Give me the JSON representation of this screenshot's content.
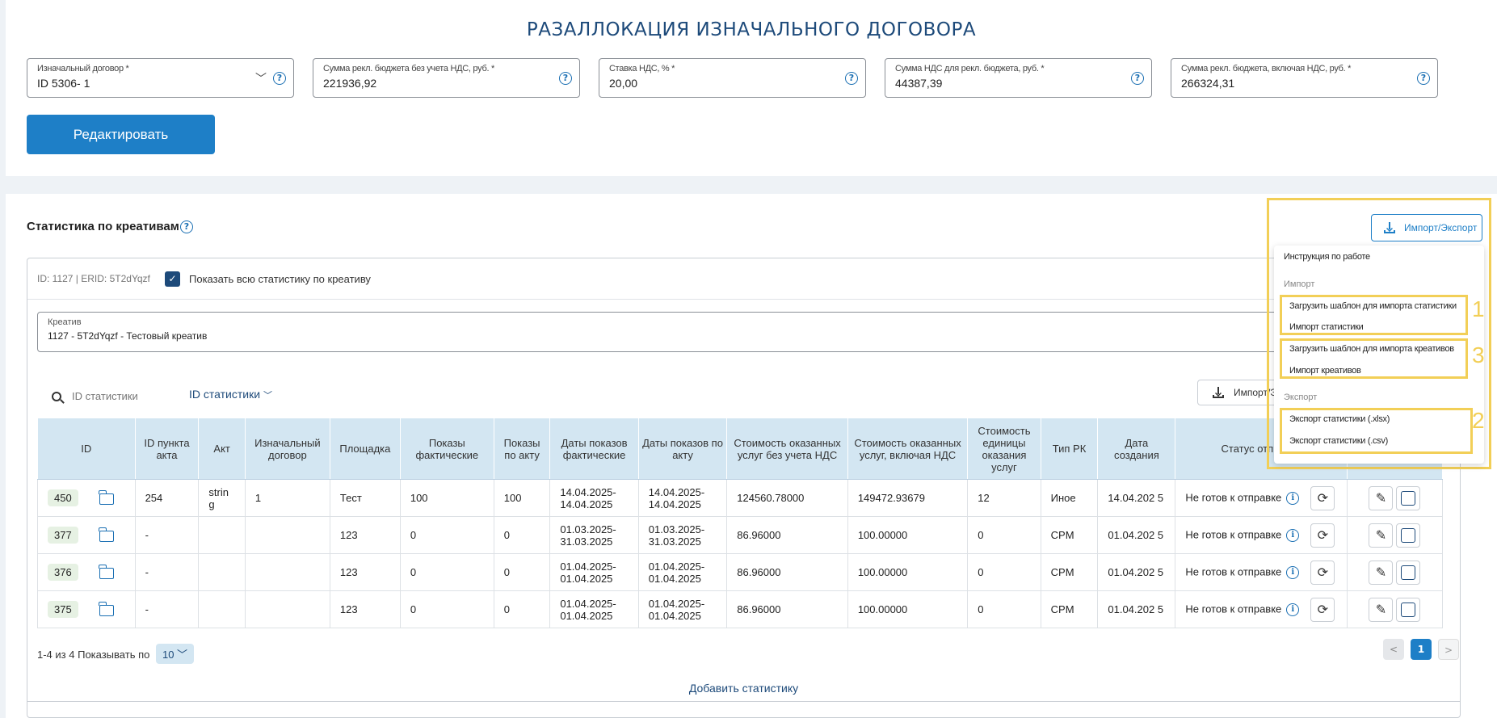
{
  "page": {
    "title": "РАЗАЛЛОКАЦИЯ ИЗНАЧАЛЬНОГО ДОГОВОРА"
  },
  "fields": [
    {
      "label": "Изначальный договор *",
      "value": "ID 5306- 1"
    },
    {
      "label": "Сумма рекл. бюджета без учета НДС, руб. *",
      "value": "221936,92"
    },
    {
      "label": "Ставка НДС, % *",
      "value": "20,00"
    },
    {
      "label": "Сумма НДС для рекл. бюджета, руб. *",
      "value": "44387,39"
    },
    {
      "label": "Сумма рекл. бюджета, включая НДС, руб. *",
      "value": "266324,31"
    }
  ],
  "edit_button": "Редактировать",
  "icons": {
    "help": "?",
    "chevron": "﹀",
    "check": "✓",
    "info": "i",
    "refresh": "⟳",
    "edit": "✎",
    "prev": "<",
    "next": ">"
  },
  "stats": {
    "title": "Статистика по креативам",
    "meta": "ID: 1127 | ERID: 5T2dYqzf",
    "show_all_label": "Показать всю статистику по креативу",
    "creative": {
      "label": "Креатив",
      "value": "1127 - 5T2dYqzf - Тестовый креатив"
    },
    "search_placeholder": "ID статистики",
    "id_select": "ID статистики",
    "small_export_label": "Импорт/Э",
    "columns": [
      "ID",
      "ID пункта акта",
      "Акт",
      "Изначальный договор",
      "Площадка",
      "Показы фактические",
      "Показы по акту",
      "Даты показов фактические",
      "Даты показов по акту",
      "Стоимость оказанных услуг без учета НДС",
      "Стоимость оказанных услуг, включая НДС",
      "Стоимость единицы оказания услуг",
      "Тип РК",
      "Дата создания",
      "Статус отправки",
      ""
    ],
    "rows": [
      {
        "id": "450",
        "act_item": "254",
        "act": "strin g",
        "contract": "1",
        "platform": "Тест",
        "shows_fact": "100",
        "shows_act": "100",
        "dates_fact": "14.04.2025- 14.04.2025",
        "dates_act": "14.04.2025- 14.04.2025",
        "cost_no_vat": "124560.78000",
        "cost_vat": "149472.93679",
        "unit_cost": "12",
        "type": "Иное",
        "created": "14.04.202 5",
        "status": "Не готов к отправке"
      },
      {
        "id": "377",
        "act_item": "-",
        "act": "",
        "contract": "",
        "platform": "123",
        "shows_fact": "0",
        "shows_act": "0",
        "dates_fact": "01.03.2025- 31.03.2025",
        "dates_act": "01.03.2025- 31.03.2025",
        "cost_no_vat": "86.96000",
        "cost_vat": "100.00000",
        "unit_cost": "0",
        "type": "CPM",
        "created": "01.04.202 5",
        "status": "Не готов к отправке"
      },
      {
        "id": "376",
        "act_item": "-",
        "act": "",
        "contract": "",
        "platform": "123",
        "shows_fact": "0",
        "shows_act": "0",
        "dates_fact": "01.04.2025- 01.04.2025",
        "dates_act": "01.04.2025- 01.04.2025",
        "cost_no_vat": "86.96000",
        "cost_vat": "100.00000",
        "unit_cost": "0",
        "type": "CPM",
        "created": "01.04.202 5",
        "status": "Не готов к отправке"
      },
      {
        "id": "375",
        "act_item": "-",
        "act": "",
        "contract": "",
        "platform": "123",
        "shows_fact": "0",
        "shows_act": "0",
        "dates_fact": "01.04.2025- 01.04.2025",
        "dates_act": "01.04.2025- 01.04.2025",
        "cost_no_vat": "86.96000",
        "cost_vat": "100.00000",
        "unit_cost": "0",
        "type": "CPM",
        "created": "01.04.202 5",
        "status": "Не готов к отправке"
      }
    ],
    "pagination": {
      "range": "1-4 из 4",
      "per_page_label": "Показывать по",
      "per_page": "10 ﹀",
      "current_page": "1"
    },
    "add_label": "Добавить статистику"
  },
  "export_menu": {
    "button": "Импорт/Экспорт",
    "instruction": "Инструкция по работе",
    "import_section": "Импорт",
    "items_import_stats": [
      "Загрузить шаблон для импорта статистики",
      "Импорт статистики"
    ],
    "items_import_creatives": [
      "Загрузить шаблон для импорта креативов",
      "Импорт креативов"
    ],
    "export_section": "Экспорт",
    "items_export": [
      "Экспорт статистики (.xlsx)",
      "Экспорт статистики (.csv)"
    ],
    "markers": [
      "1",
      "3",
      "2"
    ]
  },
  "colors": {
    "accent": "#1e7fc7",
    "title": "#1d4a7a",
    "highlight": "#f2cf57",
    "header_bg": "#d3e6f2",
    "id_badge": "#e6f1e3"
  }
}
